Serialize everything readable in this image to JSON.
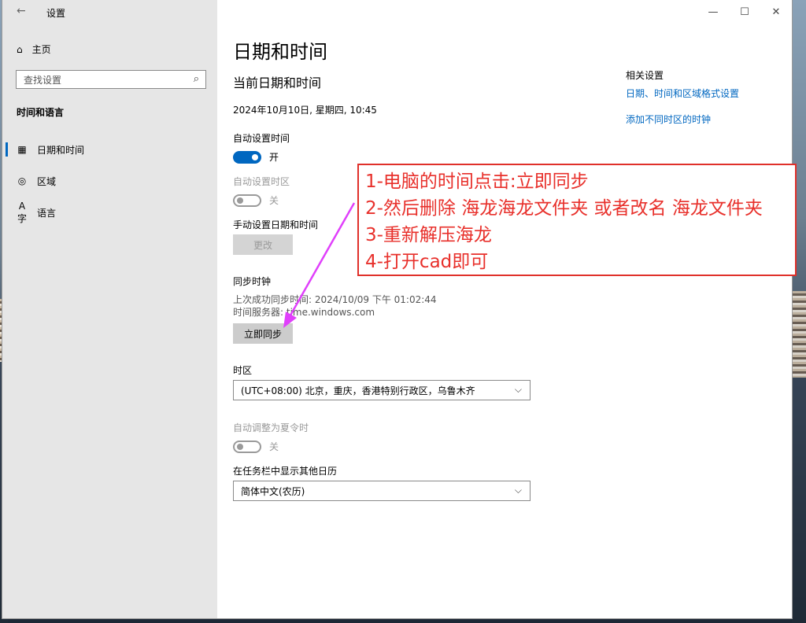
{
  "window": {
    "app_title": "设置",
    "controls": {
      "minimize": "—",
      "maximize": "☐",
      "close": "✕"
    }
  },
  "sidebar": {
    "home": "主页",
    "search_placeholder": "查找设置",
    "section": "时间和语言",
    "items": [
      {
        "label": "日期和时间",
        "icon": "calendar-clock-icon",
        "active": true
      },
      {
        "label": "区域",
        "icon": "globe-icon",
        "active": false
      },
      {
        "label": "语言",
        "icon": "language-icon",
        "active": false
      }
    ]
  },
  "main": {
    "title": "日期和时间",
    "subtitle": "当前日期和时间",
    "current_datetime": "2024年10月10日, 星期四, 10:45",
    "auto_time": {
      "label": "自动设置时间",
      "state": "开",
      "on": true
    },
    "auto_timezone": {
      "label": "自动设置时区",
      "state": "关",
      "on": false
    },
    "manual": {
      "label": "手动设置日期和时间",
      "button": "更改"
    },
    "sync": {
      "label": "同步时钟",
      "last_sync": "上次成功同步时间: 2024/10/09 下午 01:02:44",
      "server": "时间服务器: time.windows.com",
      "button": "立即同步"
    },
    "timezone": {
      "label": "时区",
      "value": "(UTC+08:00) 北京，重庆，香港特别行政区，乌鲁木齐"
    },
    "dst": {
      "label": "自动调整为夏令时",
      "state": "关",
      "on": false
    },
    "calendar": {
      "label": "在任务栏中显示其他日历",
      "value": "简体中文(农历)"
    }
  },
  "related": {
    "title": "相关设置",
    "links": [
      "日期、时间和区域格式设置",
      "添加不同时区的时钟"
    ]
  },
  "annotation": {
    "lines": [
      "1-电脑的时间点击:立即同步",
      "2-然后删除 海龙海龙文件夹 或者改名 海龙文件夹",
      "3-重新解压海龙",
      "4-打开cad即可"
    ],
    "color": "#e8302b",
    "arrow_color": "#e040fb"
  }
}
